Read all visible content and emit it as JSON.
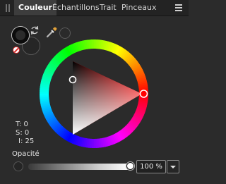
{
  "tabs": [
    {
      "label": "Couleur",
      "active": true
    },
    {
      "label": "Échantillons",
      "active": false
    },
    {
      "label": "Trait",
      "active": false
    },
    {
      "label": "Pinceaux",
      "active": false
    }
  ],
  "icons": {
    "grip": "drag-handle-icon",
    "menu": "hamburger-menu-icon",
    "swap": "swap-colors-icon",
    "none": "no-color-icon",
    "picker": "eyedropper-icon",
    "dropdown": "chevron-down-icon"
  },
  "colors": {
    "fill": "#0b0b0b",
    "selected_hue": "#ff0000",
    "picked": "#2a2a2a"
  },
  "wheel": {
    "hue_deg": 0,
    "saturation": 0,
    "intensity": 25
  },
  "tsi": {
    "t": "T: 0",
    "s": "S: 0",
    "i": "I: 25"
  },
  "opacity": {
    "label": "Opacité",
    "value_text": "100 %",
    "value": 100
  }
}
